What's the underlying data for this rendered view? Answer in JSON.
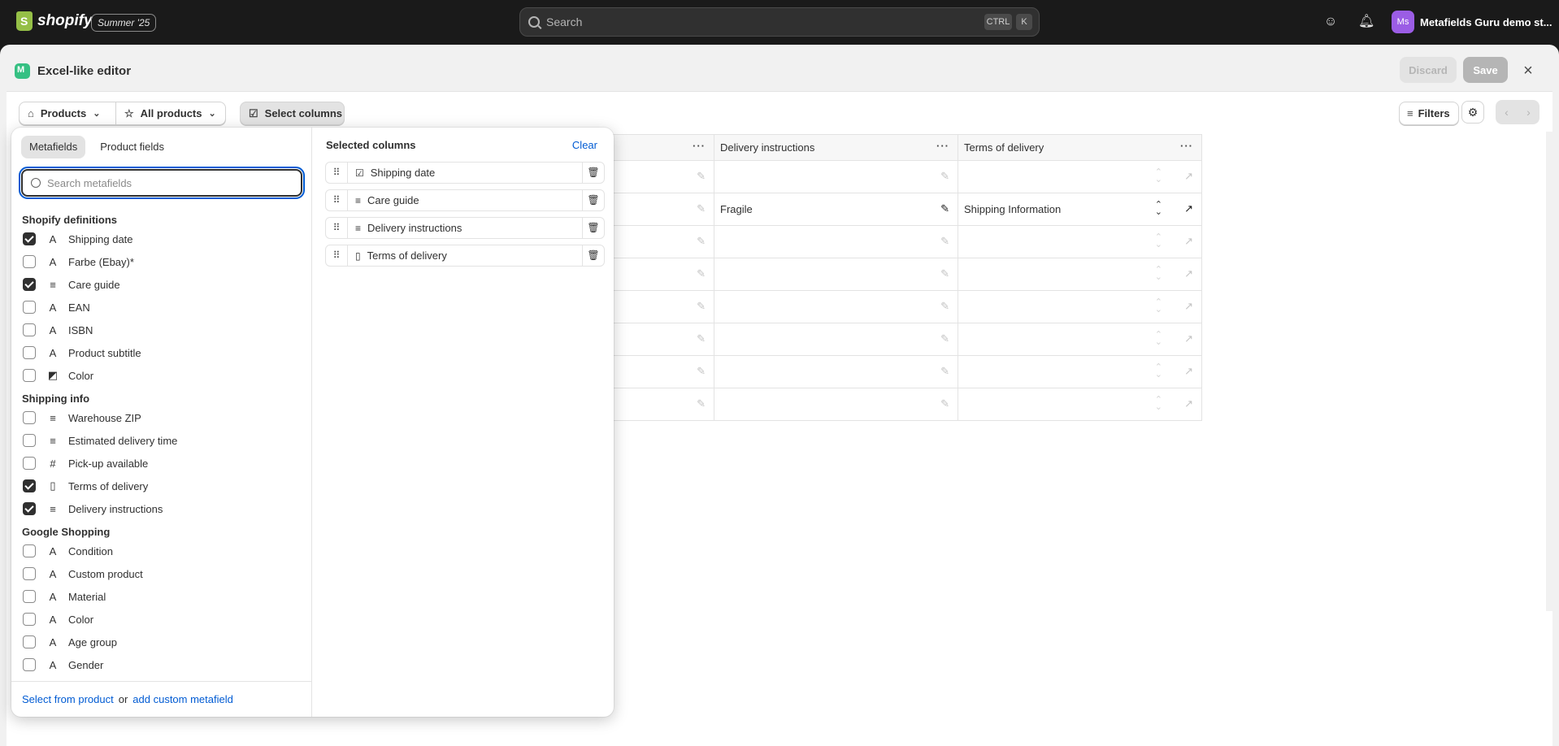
{
  "topbar": {
    "brand": "shopify",
    "edition_badge": "Summer '25",
    "search_placeholder": "Search",
    "shortcut_ctrl": "CTRL",
    "shortcut_key": "K",
    "store_initials": "Ms",
    "store_name": "Metafields Guru demo st..."
  },
  "modal": {
    "title": "Excel-like editor",
    "discard_label": "Discard",
    "save_label": "Save",
    "close_icon": "×"
  },
  "toolbar": {
    "resource_label": "Products",
    "view_label": "All products",
    "select_columns_label": "Select columns",
    "filters_label": "Filters"
  },
  "grid": {
    "columns": [
      "Delivery instructions",
      "Terms of delivery"
    ],
    "rows": [
      {
        "delivery": "",
        "terms": ""
      },
      {
        "delivery": "Fragile",
        "terms": "Shipping Information"
      },
      {
        "delivery": "",
        "terms": ""
      },
      {
        "delivery": "",
        "terms": ""
      },
      {
        "delivery": "",
        "terms": ""
      },
      {
        "delivery": "",
        "terms": ""
      },
      {
        "delivery": "",
        "terms": ""
      },
      {
        "delivery": "",
        "terms": ""
      }
    ]
  },
  "column_picker": {
    "tabs": [
      "Metafields",
      "Product fields"
    ],
    "search_placeholder": "Search metafields",
    "groups": [
      {
        "title": "Shopify definitions",
        "items": [
          {
            "label": "Shipping date",
            "checked": true,
            "type_icon": "text-icon"
          },
          {
            "label": "Farbe (Ebay)*",
            "checked": false,
            "type_icon": "text-icon"
          },
          {
            "label": "Care guide",
            "checked": true,
            "type_icon": "multiline-icon"
          },
          {
            "label": "EAN",
            "checked": false,
            "type_icon": "text-icon"
          },
          {
            "label": "ISBN",
            "checked": false,
            "type_icon": "text-icon"
          },
          {
            "label": "Product subtitle",
            "checked": false,
            "type_icon": "text-icon"
          },
          {
            "label": "Color",
            "checked": false,
            "type_icon": "color-icon"
          }
        ]
      },
      {
        "title": "Shipping info",
        "items": [
          {
            "label": "Warehouse ZIP",
            "checked": false,
            "type_icon": "multiline-icon"
          },
          {
            "label": "Estimated delivery time",
            "checked": false,
            "type_icon": "multiline-icon"
          },
          {
            "label": "Pick-up available",
            "checked": false,
            "type_icon": "number-icon"
          },
          {
            "label": "Terms of delivery",
            "checked": true,
            "type_icon": "page-icon"
          },
          {
            "label": "Delivery instructions",
            "checked": true,
            "type_icon": "multiline-icon"
          }
        ]
      },
      {
        "title": "Google Shopping",
        "items": [
          {
            "label": "Condition",
            "checked": false,
            "type_icon": "text-icon"
          },
          {
            "label": "Custom product",
            "checked": false,
            "type_icon": "text-icon"
          },
          {
            "label": "Material",
            "checked": false,
            "type_icon": "text-icon"
          },
          {
            "label": "Color",
            "checked": false,
            "type_icon": "text-icon"
          },
          {
            "label": "Age group",
            "checked": false,
            "type_icon": "text-icon"
          },
          {
            "label": "Gender",
            "checked": false,
            "type_icon": "text-icon"
          }
        ]
      }
    ],
    "footer_link1": "Select from product",
    "footer_or": "or",
    "footer_link2": "add custom metafield",
    "selected_title": "Selected columns",
    "clear_label": "Clear",
    "selected": [
      {
        "label": "Shipping date",
        "type_icon": "date-icon"
      },
      {
        "label": "Care guide",
        "type_icon": "multiline-icon"
      },
      {
        "label": "Delivery instructions",
        "type_icon": "multiline-icon"
      },
      {
        "label": "Terms of delivery",
        "type_icon": "page-icon"
      }
    ]
  },
  "colors": {
    "accent_link": "#005bd3",
    "topbar_bg": "#1a1a1a",
    "avatar": "#9b5de5",
    "app_icon": "#36c083"
  }
}
